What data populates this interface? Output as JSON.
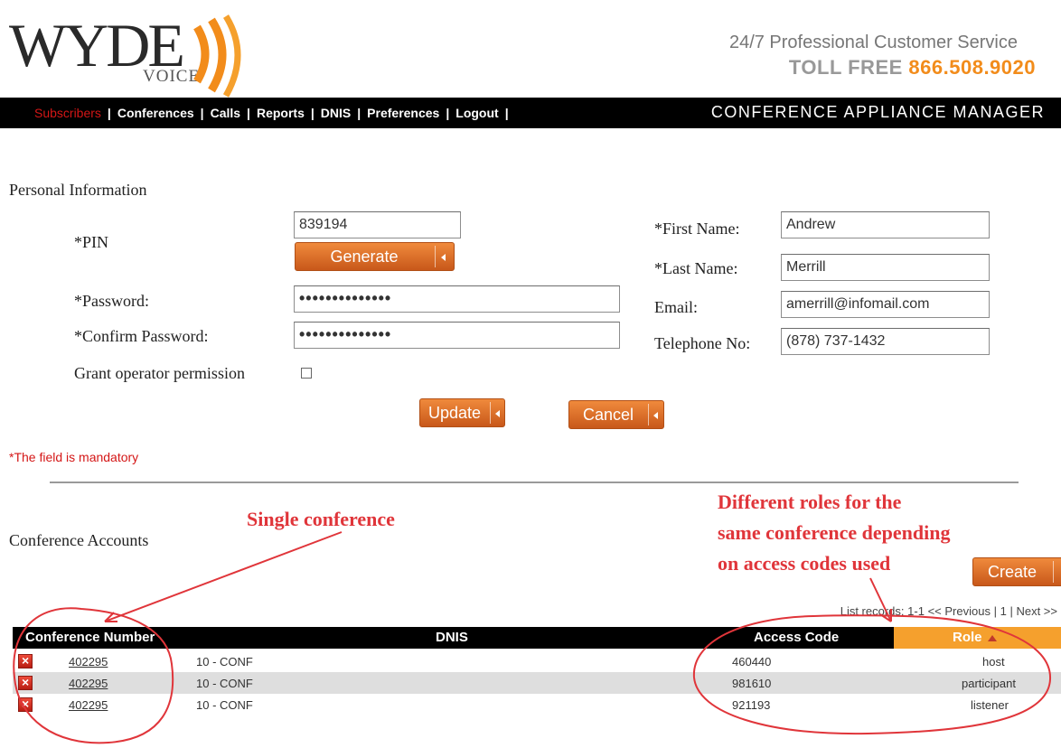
{
  "brand": {
    "logo_main": "WYDE",
    "logo_sub": "VOICE",
    "service_line": "24/7 Professional Customer Service",
    "toll_free_label": "TOLL FREE",
    "toll_free_number": "866.508.9020",
    "accent_color": "#f28c1b"
  },
  "nav": {
    "items": [
      {
        "label": "Subscribers",
        "active": true
      },
      {
        "label": "Conferences"
      },
      {
        "label": "Calls"
      },
      {
        "label": "Reports"
      },
      {
        "label": "DNIS"
      },
      {
        "label": "Preferences"
      },
      {
        "label": "Logout"
      }
    ],
    "separator": "|",
    "app_title": "CONFERENCE APPLIANCE MANAGER"
  },
  "personal": {
    "heading": "Personal Information",
    "pin_label": "*PIN",
    "pin_value": "839194",
    "generate_label": "Generate",
    "password_label": "*Password:",
    "password_value": "••••••••••••••",
    "confirm_label": "*Confirm Password:",
    "confirm_value": "••••••••••••••",
    "operator_label": "Grant operator permission",
    "operator_checked": false,
    "first_name_label": "*First Name:",
    "first_name_value": "Andrew",
    "last_name_label": "*Last Name:",
    "last_name_value": "Merrill",
    "email_label": "Email:",
    "email_value": "amerrill@infomail.com",
    "phone_label": "Telephone No:",
    "phone_value": "(878) 737-1432",
    "update_label": "Update",
    "cancel_label": "Cancel",
    "mandatory_note": "*The field is mandatory"
  },
  "conference_accounts": {
    "heading": "Conference Accounts",
    "create_label": "Create",
    "pager": {
      "prefix": "List records:",
      "range": "1-1",
      "previous": "<< Previous",
      "page": "1",
      "next": "Next >>"
    },
    "columns": {
      "number": "Conference Number",
      "dnis": "DNIS",
      "access": "Access Code",
      "role": "Role"
    },
    "rows": [
      {
        "number": "402295",
        "dnis": "10 - CONF",
        "access": "460440",
        "role": "host"
      },
      {
        "number": "402295",
        "dnis": "10 - CONF",
        "access": "981610",
        "role": "participant"
      },
      {
        "number": "402295",
        "dnis": "10 - CONF",
        "access": "921193",
        "role": "listener"
      }
    ]
  },
  "annotations": {
    "single": "Single conference",
    "roles_line1": "Different roles for the",
    "roles_line2": "same conference depending",
    "roles_line3": "on access codes used",
    "color": "#e0353a"
  }
}
